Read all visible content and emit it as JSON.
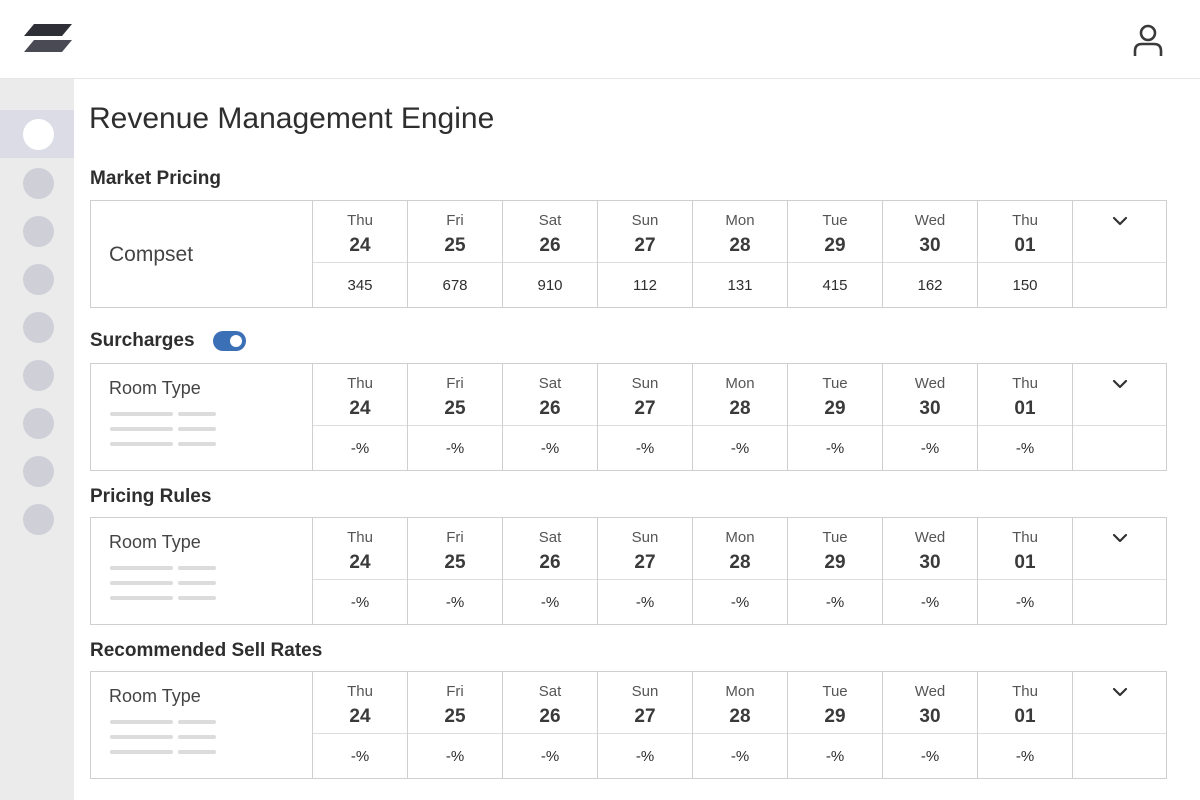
{
  "app": {
    "title": "Revenue Management Engine",
    "logo_icon": "stacked-layers-logo",
    "user_icon": "user-icon",
    "accent_color": "#3b6fb6"
  },
  "sidebar": {
    "item_count": 9,
    "active_index": 0
  },
  "days": [
    {
      "dow": "Thu",
      "num": "24"
    },
    {
      "dow": "Fri",
      "num": "25"
    },
    {
      "dow": "Sat",
      "num": "26"
    },
    {
      "dow": "Sun",
      "num": "27"
    },
    {
      "dow": "Mon",
      "num": "28"
    },
    {
      "dow": "Tue",
      "num": "29"
    },
    {
      "dow": "Wed",
      "num": "30"
    },
    {
      "dow": "Thu",
      "num": "01"
    }
  ],
  "sections": [
    {
      "title": "Market Pricing",
      "row_label": "Compset",
      "label_style": "compset",
      "values": [
        "345",
        "678",
        "910",
        "112",
        "131",
        "415",
        "162",
        "150"
      ]
    },
    {
      "title": "Surcharges",
      "row_label": "Room Type",
      "label_style": "roomtype",
      "toggle": {
        "on": true
      },
      "values": [
        "-%",
        "-%",
        "-%",
        "-%",
        "-%",
        "-%",
        "-%",
        "-%"
      ]
    },
    {
      "title": "Pricing Rules",
      "row_label": "Room Type",
      "label_style": "roomtype",
      "values": [
        "-%",
        "-%",
        "-%",
        "-%",
        "-%",
        "-%",
        "-%",
        "-%"
      ]
    },
    {
      "title": "Recommended Sell Rates",
      "row_label": "Room Type",
      "label_style": "roomtype",
      "values": [
        "-%",
        "-%",
        "-%",
        "-%",
        "-%",
        "-%",
        "-%",
        "-%"
      ]
    }
  ]
}
